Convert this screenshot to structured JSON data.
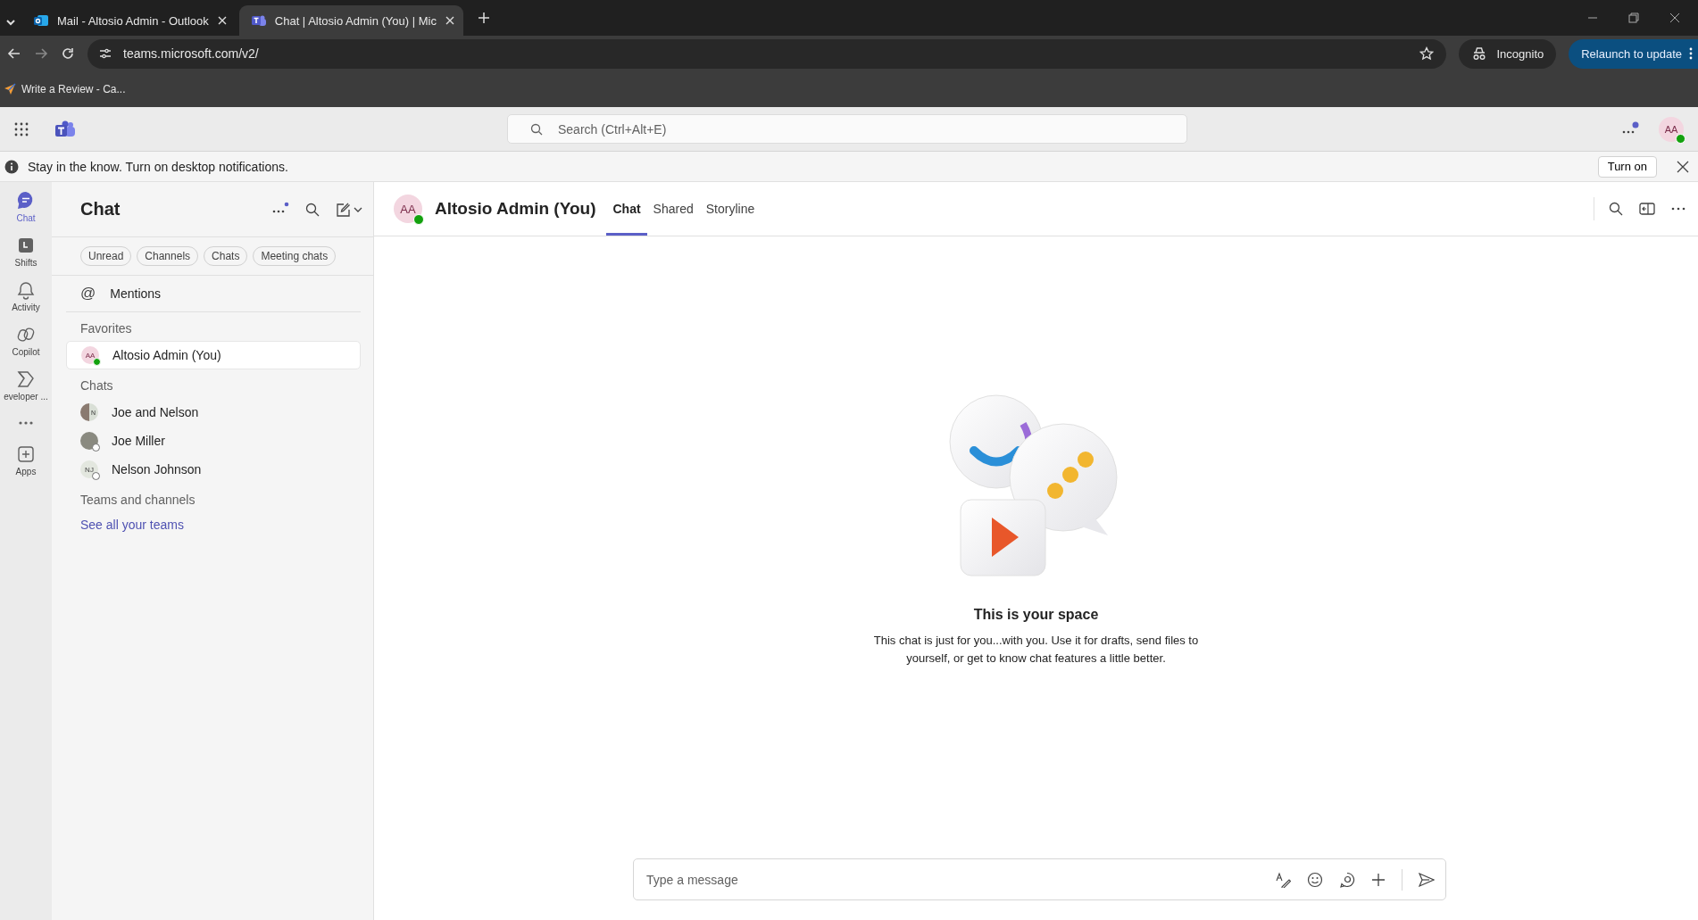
{
  "browser": {
    "tabs": [
      {
        "title": "Mail - Altosio Admin - Outlook",
        "kind": "outlook",
        "selected": false
      },
      {
        "title": "Chat | Altosio Admin (You) | Mic",
        "kind": "teams",
        "selected": true
      }
    ],
    "address": "teams.microsoft.com/v2/",
    "incognito": "Incognito",
    "relaunch": "Relaunch to update",
    "bookmarks": [
      {
        "title": "Write a Review - Ca..."
      }
    ]
  },
  "app_header": {
    "search": {
      "placeholder": "Search (Ctrl+Alt+E)"
    },
    "avatar": "AA",
    "available": true
  },
  "notification": {
    "text": "Stay in the know. Turn on desktop notifications.",
    "button": "Turn on"
  },
  "rail": [
    {
      "label": "Chat",
      "kind": "chat",
      "selected": true
    },
    {
      "label": "Shifts",
      "kind": "shifts",
      "selected": false
    },
    {
      "label": "Activity",
      "kind": "activity",
      "selected": false
    },
    {
      "label": "Copilot",
      "kind": "copilot",
      "selected": false
    },
    {
      "label": "eveloper ...",
      "kind": "developer",
      "selected": false
    },
    {
      "kind": "more",
      "selected": false
    },
    {
      "label": "Apps",
      "kind": "apps",
      "selected": false
    }
  ],
  "chat_list": {
    "title": "Chat",
    "filters": [
      "Unread",
      "Channels",
      "Chats",
      "Meeting chats"
    ],
    "mentions": {
      "icon": "@",
      "label": "Mentions"
    },
    "sections": [
      {
        "title": "Favorites",
        "items": [
          {
            "name": "Altosio Admin (You)",
            "avatar": "AA",
            "photo": false,
            "available": true,
            "selected": true
          }
        ]
      },
      {
        "title": "Chats",
        "items": [
          {
            "name": "Joe and Nelson",
            "avatar": "N",
            "photo": true,
            "selected": false
          },
          {
            "name": "Joe Miller",
            "photo": true,
            "available": false,
            "selected": false
          },
          {
            "name": "Nelson Johnson",
            "avatar": "NJ",
            "photo": false,
            "available": false,
            "selected": false
          }
        ]
      },
      {
        "title": "Teams and channels",
        "link": "See all your teams"
      }
    ]
  },
  "conversation": {
    "avatar": "AA",
    "available": true,
    "name": "Altosio Admin (You)",
    "tabs": [
      {
        "label": "Chat",
        "selected": true
      },
      {
        "label": "Shared",
        "selected": false
      },
      {
        "label": "Storyline",
        "selected": false
      }
    ],
    "empty_state": {
      "title": "This is your space",
      "text": "This chat is just for you...with you. Use it for drafts, send files to yourself, or get to know chat features a little better."
    },
    "composer": {
      "placeholder": "Type a message"
    }
  }
}
